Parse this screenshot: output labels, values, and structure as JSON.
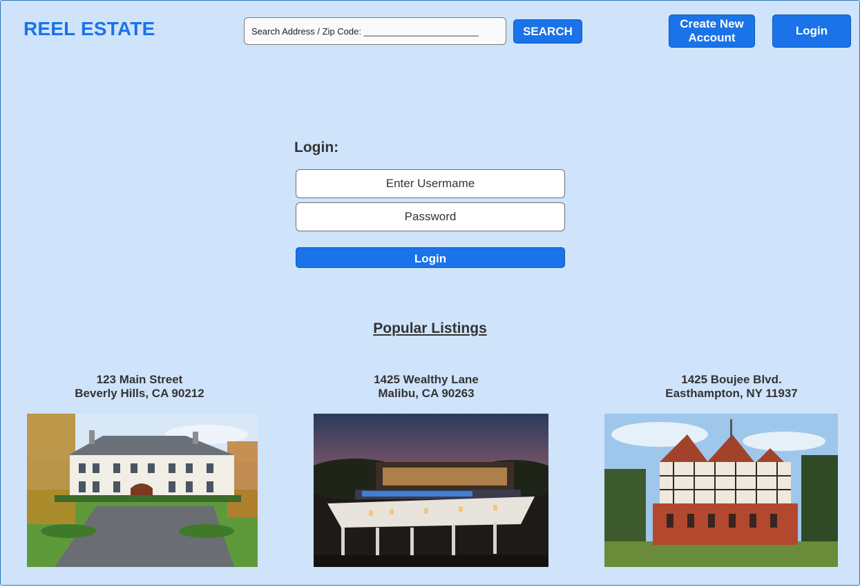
{
  "brand": {
    "name": "REEL ESTATE"
  },
  "header": {
    "search_text": "Search Address / Zip Code: _______________________",
    "search_button": "SEARCH",
    "create_account_button": "Create New Account",
    "login_button": "Login"
  },
  "login_form": {
    "heading": "Login:",
    "username_placeholder": "Enter Usermame",
    "password_placeholder": "Password",
    "submit_label": "Login"
  },
  "popular": {
    "heading": "Popular Listings",
    "listings": [
      {
        "street": "123 Main Street",
        "city": "Beverly Hills, CA 90212",
        "image": "white-mansion-photo"
      },
      {
        "street": "1425 Wealthy Lane",
        "city": "Malibu, CA 90263",
        "image": "modern-hillside-home-night-photo"
      },
      {
        "street": "1425 Boujee Blvd.",
        "city": "Easthampton, NY 11937",
        "image": "tudor-brick-mansion-photo"
      }
    ]
  },
  "colors": {
    "background": "#cfe3fb",
    "accent": "#1a73e8"
  }
}
